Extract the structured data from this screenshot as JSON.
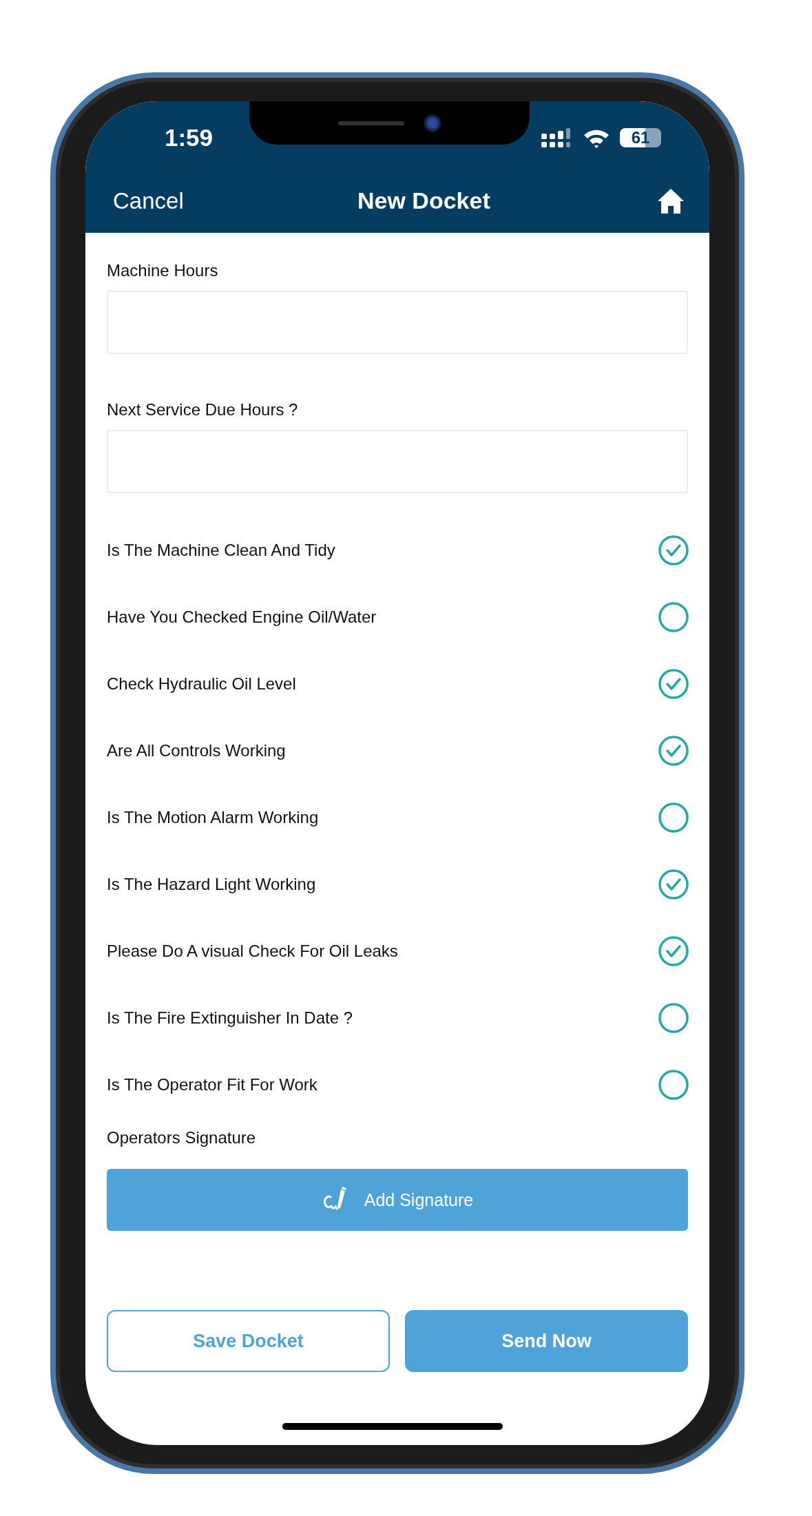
{
  "status_bar": {
    "time": "1:59",
    "battery": "61"
  },
  "nav": {
    "cancel": "Cancel",
    "title": "New Docket"
  },
  "fields": [
    {
      "label": "Machine Hours"
    },
    {
      "label": "Next Service Due Hours ?"
    }
  ],
  "checklist": [
    {
      "label": "Is The Machine Clean And Tidy",
      "checked": true
    },
    {
      "label": "Have You Checked Engine Oil/Water",
      "checked": false
    },
    {
      "label": "Check Hydraulic Oil Level",
      "checked": true
    },
    {
      "label": "Are All Controls Working",
      "checked": true
    },
    {
      "label": "Is The Motion Alarm Working",
      "checked": false
    },
    {
      "label": "Is The Hazard Light Working",
      "checked": true
    },
    {
      "label": "Please Do A visual Check For Oil Leaks",
      "checked": true
    },
    {
      "label": "Is The Fire Extinguisher In Date ?",
      "checked": false
    },
    {
      "label": "Is The Operator Fit For Work",
      "checked": false
    }
  ],
  "signature": {
    "label": "Operators Signature",
    "button": "Add Signature"
  },
  "buttons": [
    {
      "label": "Save Docket",
      "kind": "outline"
    },
    {
      "label": "Send Now",
      "kind": "filled"
    }
  ]
}
